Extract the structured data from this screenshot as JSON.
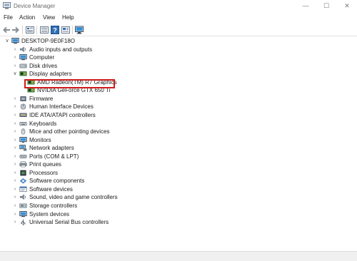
{
  "window": {
    "title": "Device Manager",
    "controls": {
      "minimize": "—",
      "maximize": "☐",
      "close": "✕"
    }
  },
  "menu": [
    "File",
    "Action",
    "View",
    "Help"
  ],
  "tree": {
    "root": "DESKTOP-9E0F18O",
    "items": [
      {
        "label": "Audio inputs and outputs",
        "icon": "speaker-icon",
        "expanded": false
      },
      {
        "label": "Computer",
        "icon": "computer-icon",
        "expanded": false
      },
      {
        "label": "Disk drives",
        "icon": "disk-drive-icon",
        "expanded": false
      },
      {
        "label": "Display adapters",
        "icon": "display-adapter-icon",
        "expanded": true,
        "children": [
          {
            "label": "AMD Radeon(TM) R7 Graphics",
            "icon": "display-adapter-icon",
            "highlighted": true
          },
          {
            "label": "NVIDIA GeForce GTX 650 Ti",
            "icon": "display-adapter-icon",
            "highlighted": false
          }
        ]
      },
      {
        "label": "Firmware",
        "icon": "firmware-icon",
        "expanded": false
      },
      {
        "label": "Human Interface Devices",
        "icon": "hid-icon",
        "expanded": false
      },
      {
        "label": "IDE ATA/ATAPI controllers",
        "icon": "ide-controller-icon",
        "expanded": false
      },
      {
        "label": "Keyboards",
        "icon": "keyboard-icon",
        "expanded": false
      },
      {
        "label": "Mice and other pointing devices",
        "icon": "mouse-icon",
        "expanded": false
      },
      {
        "label": "Monitors",
        "icon": "monitor-icon",
        "expanded": false
      },
      {
        "label": "Network adapters",
        "icon": "network-adapter-icon",
        "expanded": false
      },
      {
        "label": "Ports (COM & LPT)",
        "icon": "port-icon",
        "expanded": false
      },
      {
        "label": "Print queues",
        "icon": "printer-icon",
        "expanded": false
      },
      {
        "label": "Processors",
        "icon": "processor-icon",
        "expanded": false
      },
      {
        "label": "Software components",
        "icon": "software-component-icon",
        "expanded": false
      },
      {
        "label": "Software devices",
        "icon": "software-device-icon",
        "expanded": false
      },
      {
        "label": "Sound, video and game controllers",
        "icon": "sound-icon",
        "expanded": false
      },
      {
        "label": "Storage controllers",
        "icon": "storage-controller-icon",
        "expanded": false
      },
      {
        "label": "System devices",
        "icon": "system-device-icon",
        "expanded": false
      },
      {
        "label": "Universal Serial Bus controllers",
        "icon": "usb-icon",
        "expanded": false
      }
    ]
  },
  "colors": {
    "highlight_border": "#d11b1b",
    "icon_blue": "#2f6fb5",
    "icon_dark": "#3b4a5c"
  }
}
